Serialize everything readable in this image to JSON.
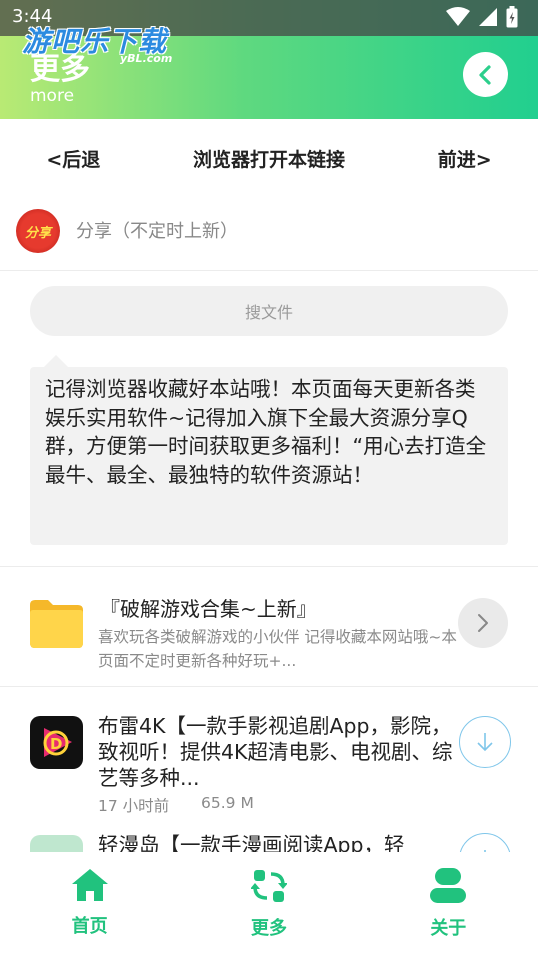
{
  "status_bar": {
    "time": "3:44"
  },
  "watermark": {
    "main": "游吧乐下载",
    "sub": "yBL.com"
  },
  "header": {
    "title": "更多",
    "subtitle": "more"
  },
  "nav": {
    "back": "<后退",
    "open_browser": "浏览器打开本链接",
    "forward": "前进>"
  },
  "share": {
    "badge": "分享",
    "text": "分享（不定时上新）"
  },
  "search": {
    "placeholder": "搜文件"
  },
  "notice": {
    "text": "记得浏览器收藏好本站哦！本页面每天更新各类娱乐实用软件~记得加入旗下全最大资源分享Q群，方便第一时间获取更多福利！“用心去打造全最牛、最全、最独特的软件资源站！"
  },
  "folder": {
    "title": "『破解游戏合集~上新』",
    "description": "喜欢玩各类破解游戏的小伙伴 记得收藏本网站哦~本页面不定时更新各种好玩+..."
  },
  "apps": [
    {
      "title": "布雷4K【一款手影视追剧App，影院，致视听！提供4K超清电影、电视剧、综艺等多种...",
      "time": "17 小时前",
      "size": "65.9 M",
      "icon": "play-logo-icon"
    },
    {
      "title": "轻漫岛【一款手漫画阅读App，轻",
      "icon": "comic-logo-icon"
    }
  ],
  "tabs": [
    {
      "label": "首页",
      "icon": "home-icon"
    },
    {
      "label": "更多",
      "icon": "switch-icon"
    },
    {
      "label": "关于",
      "icon": "user-icon"
    }
  ],
  "colors": {
    "accent": "#21c27e",
    "header_start": "#b9ea74",
    "header_end": "#21cf8f"
  }
}
